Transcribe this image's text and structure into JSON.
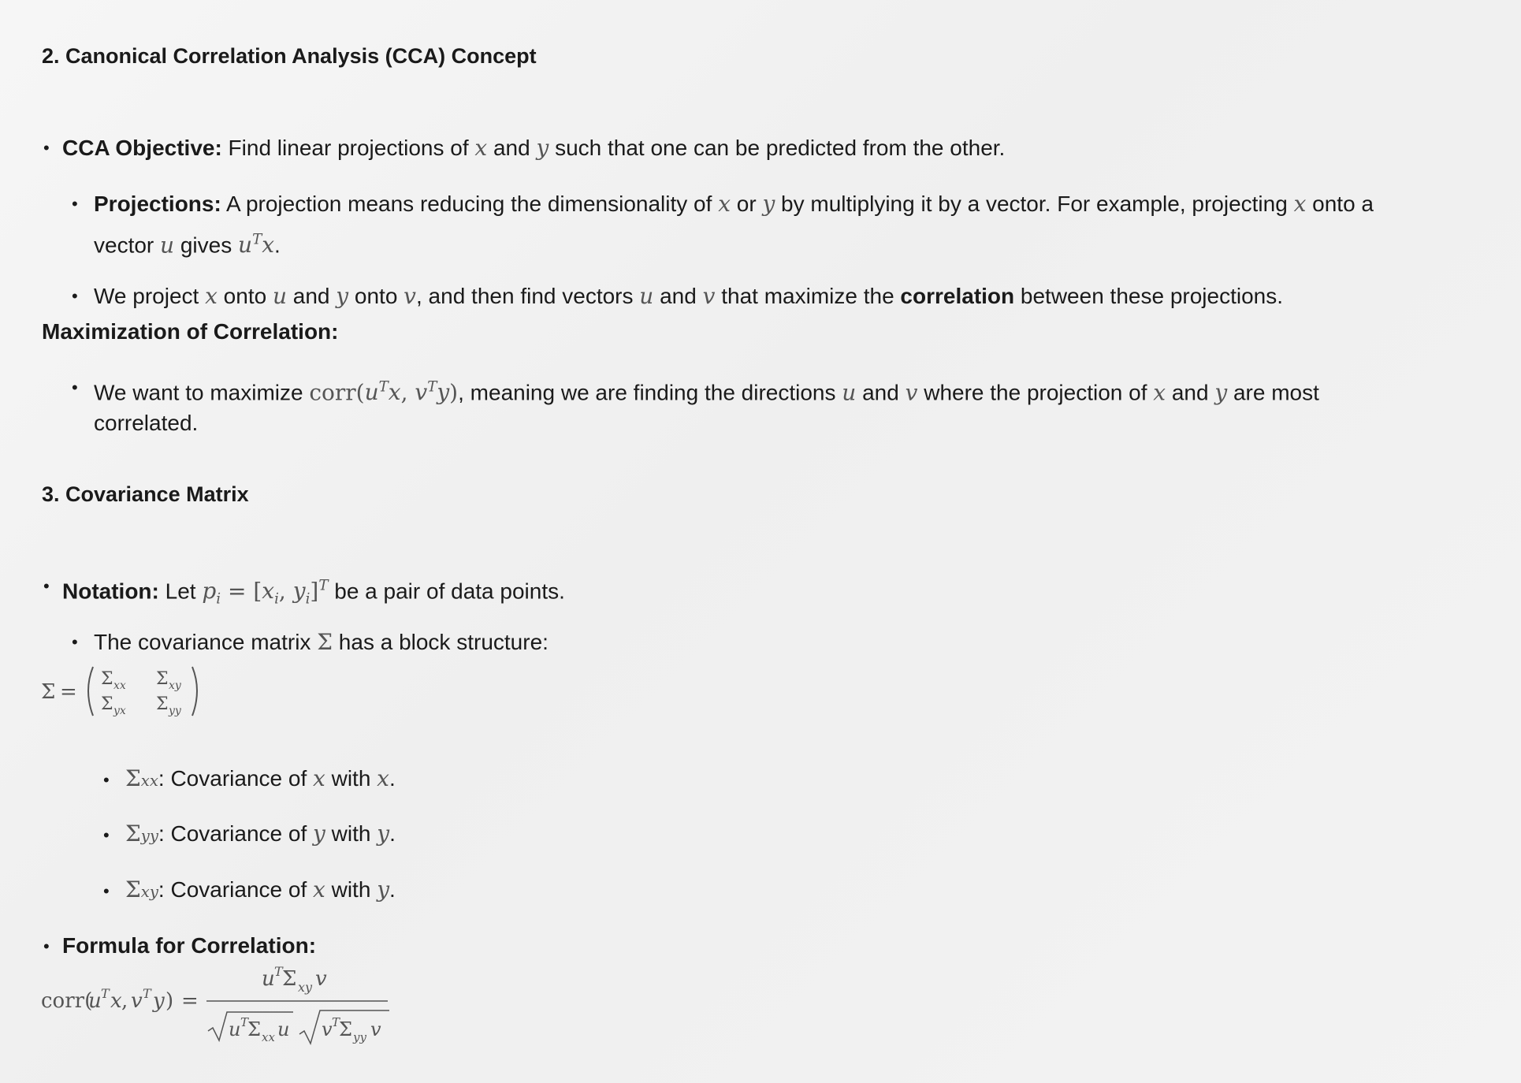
{
  "s2": {
    "heading": "2. Canonical Correlation Analysis (CCA) Concept",
    "b1_label": "CCA Objective:",
    "b1_a": " Find linear projections of ",
    "b1_b": " and ",
    "b1_c": " such that one can be predicted from the other.",
    "b2_label": "Projections:",
    "b2_a": " A projection means reducing the dimensionality of ",
    "b2_b": " or ",
    "b2_c": " by multiplying it by a vector. For example, projecting ",
    "b2_d": " onto a",
    "b2_e": "vector ",
    "b2_f": " gives ",
    "b2_g": ".",
    "b3_a": "We project ",
    "b3_b": " onto ",
    "b3_c": " and ",
    "b3_d": " onto ",
    "b3_e": ", and then find vectors ",
    "b3_f": " and ",
    "b3_g": " that maximize the ",
    "b3_bold": "correlation",
    "b3_h": " between these projections.",
    "max_heading": "Maximization of Correlation:",
    "b4_a": "We want to maximize ",
    "b4_b": ", meaning we are finding the directions ",
    "b4_c": " and ",
    "b4_d": " where the projection of ",
    "b4_e": " and ",
    "b4_f": " are most",
    "b4_g": "correlated."
  },
  "s3": {
    "heading": "3. Covariance Matrix",
    "n_label": "Notation:",
    "n_a": " Let ",
    "n_b": " be a pair of data points.",
    "c_a": "The covariance matrix ",
    "c_b": " has a block structure:",
    "sxx_text": ": Covariance of ",
    "sxx_with": " with ",
    "syy_text": ": Covariance of ",
    "syy_with": " with ",
    "sxy_text": ": Covariance of ",
    "sxy_with": " with ",
    "formula_label": "Formula for Correlation:"
  }
}
